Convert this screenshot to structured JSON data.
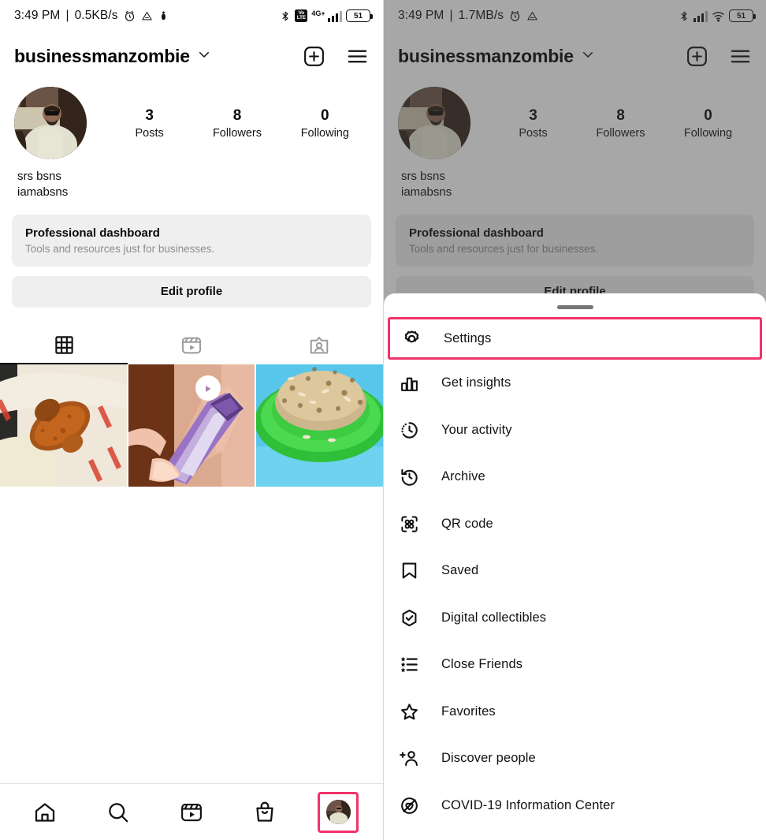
{
  "left_panel": {
    "status_bar": {
      "time": "3:49 PM",
      "separator": "|",
      "data_rate": "0.5KB/s",
      "icons_left": [
        "alarm-clock-icon",
        "drive-triangle-icon",
        "figure-icon"
      ],
      "icons_right": [
        "bluetooth-icon",
        "volte-icon",
        "signal-4gplus-icon",
        "battery-icon"
      ],
      "network_label": "4G+",
      "volte_label": "VoLTE",
      "battery_level": "51"
    },
    "header": {
      "username": "businessmanzombie",
      "chevron": "chevron-down-icon",
      "add_label": "add-post-icon",
      "menu_label": "hamburger-menu-icon"
    },
    "profile": {
      "avatar": "profile-photo",
      "stats": [
        {
          "num": "3",
          "label": "Posts"
        },
        {
          "num": "8",
          "label": "Followers"
        },
        {
          "num": "0",
          "label": "Following"
        }
      ],
      "display_name": "srs bsns",
      "bio_handle": "iamabsns",
      "dashboard_title": "Professional dashboard",
      "dashboard_subtitle": "Tools and resources just for businesses.",
      "edit_profile_label": "Edit profile"
    },
    "tabs": [
      {
        "name": "grid-tab",
        "icon": "grid-icon",
        "active": true
      },
      {
        "name": "reels-tab",
        "icon": "reels-icon",
        "active": false
      },
      {
        "name": "tagged-tab",
        "icon": "tagged-person-icon",
        "active": false
      }
    ],
    "posts": [
      {
        "alt": "fried-chicken-post",
        "is_reel": false
      },
      {
        "alt": "amethyst-crystal-post",
        "is_reel": true
      },
      {
        "alt": "rice-plate-post",
        "is_reel": false
      }
    ],
    "bottom_nav": [
      {
        "name": "home-tab",
        "icon": "home-icon",
        "selected": false
      },
      {
        "name": "search-tab",
        "icon": "search-icon",
        "selected": false
      },
      {
        "name": "reels-tab",
        "icon": "reels-icon",
        "selected": false
      },
      {
        "name": "shop-tab",
        "icon": "shopping-bag-icon",
        "selected": false
      },
      {
        "name": "profile-tab",
        "icon": "profile-avatar-icon",
        "selected": true
      }
    ]
  },
  "right_panel": {
    "status_bar": {
      "time": "3:49 PM",
      "separator": "|",
      "data_rate": "1.7MB/s",
      "icons_left": [
        "alarm-clock-icon",
        "drive-triangle-icon"
      ],
      "icons_right": [
        "bluetooth-icon",
        "signal-icon",
        "wifi-icon",
        "battery-icon"
      ],
      "battery_level": "51"
    },
    "sheet": {
      "grabber": "drag-handle",
      "items": [
        {
          "label": "Settings",
          "icon": "settings-gear-icon",
          "highlighted": true
        },
        {
          "label": "Get insights",
          "icon": "bar-chart-icon",
          "highlighted": false
        },
        {
          "label": "Your activity",
          "icon": "clock-activity-icon",
          "highlighted": false
        },
        {
          "label": "Archive",
          "icon": "archive-clock-back-icon",
          "highlighted": false
        },
        {
          "label": "QR code",
          "icon": "qr-code-icon",
          "highlighted": false
        },
        {
          "label": "Saved",
          "icon": "bookmark-icon",
          "highlighted": false
        },
        {
          "label": "Digital collectibles",
          "icon": "hexagon-check-icon",
          "highlighted": false
        },
        {
          "label": "Close Friends",
          "icon": "star-list-icon",
          "highlighted": false
        },
        {
          "label": "Favorites",
          "icon": "star-icon",
          "highlighted": false
        },
        {
          "label": "Discover people",
          "icon": "add-person-icon",
          "highlighted": false
        },
        {
          "label": "COVID-19 Information Center",
          "icon": "heart-shield-icon",
          "highlighted": false
        }
      ]
    }
  },
  "colors": {
    "highlight": "#f0336a",
    "surface": "#efefef",
    "text": "#0a0a0a",
    "muted": "#8d8d8d"
  }
}
